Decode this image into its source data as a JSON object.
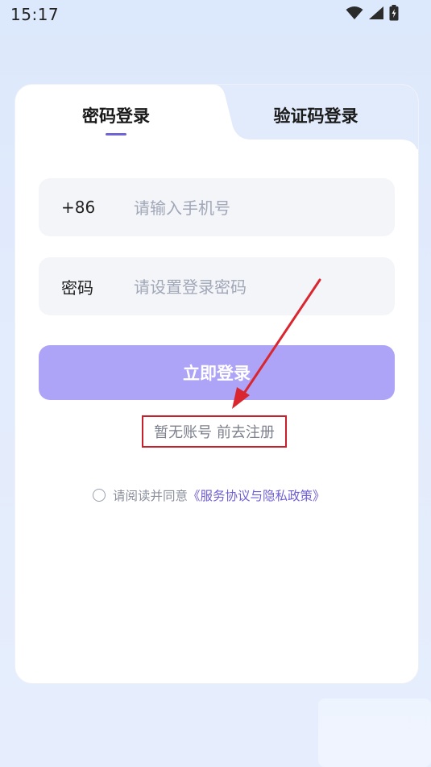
{
  "status_bar": {
    "time": "15:17",
    "icons": [
      "wifi-icon",
      "signal-icon",
      "battery-icon"
    ]
  },
  "tabs": [
    {
      "label": "密码登录",
      "active": true
    },
    {
      "label": "验证码登录",
      "active": false
    }
  ],
  "form": {
    "phone": {
      "prefix": "+86",
      "placeholder": "请输入手机号",
      "value": ""
    },
    "password": {
      "label": "密码",
      "placeholder": "请设置登录密码",
      "value": ""
    },
    "login_button": "立即登录"
  },
  "register_link": "暂无账号 前去注册",
  "agreement": {
    "checked": false,
    "text": "请阅读并同意",
    "link": "《服务协议与隐私政策》"
  },
  "colors": {
    "accent": "#6f63d8",
    "button": "#ada4f7",
    "annotation": "#d9262f",
    "background": "#dce8fb"
  }
}
